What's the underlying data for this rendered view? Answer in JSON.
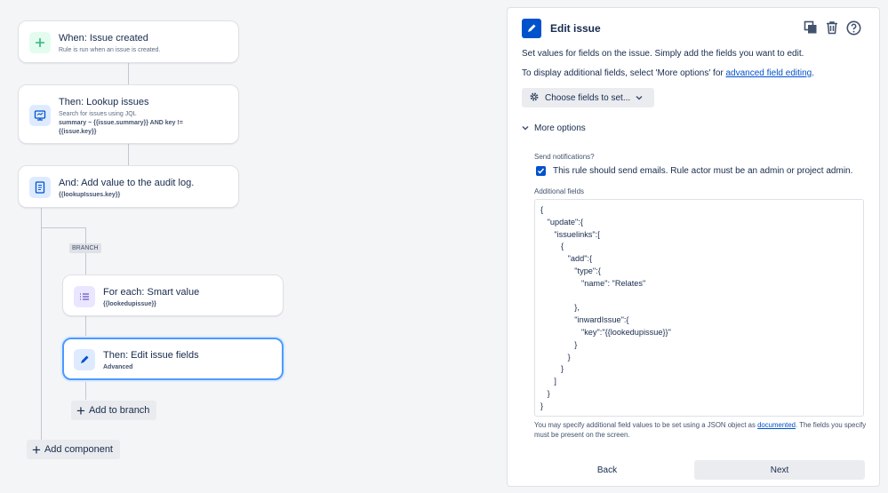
{
  "flow": {
    "trigger": {
      "title": "When: Issue created",
      "subtitle": "Rule is run when an issue is created."
    },
    "lookup": {
      "title": "Then: Lookup issues",
      "subtitle": "Search for issues using JQL",
      "jql_line1": "summary ~ {{issue.summary}} AND key !=",
      "jql_line2": "{{issue.key}}"
    },
    "audit": {
      "title": "And: Add value to the audit log.",
      "subtitle": "{{lookupIssues.key}}"
    },
    "branch_tag": "BRANCH",
    "foreach": {
      "title": "For each: Smart value",
      "subtitle": "{{lookedupissue}}"
    },
    "edit": {
      "title": "Then: Edit issue fields",
      "subtitle": "Advanced"
    },
    "add_to_branch": "Add to branch",
    "add_component": "Add component"
  },
  "panel": {
    "title": "Edit issue",
    "desc1": "Set values for fields on the issue. Simply add the fields you want to edit.",
    "desc2_prefix": "To display additional fields, select 'More options' for ",
    "desc2_link": "advanced field editing",
    "desc2_suffix": ".",
    "choose_fields": "Choose fields to set...",
    "more_options": "More options",
    "send_notifications_label": "Send notifications?",
    "send_notifications_text": "This rule should send emails. Rule actor must be an admin or project admin.",
    "send_notifications_checked": true,
    "additional_fields_label": "Additional fields",
    "additional_fields_value": "{\n   \"update\":{\n      \"issuelinks\":[\n         {\n            \"add\":{\n               \"type\":{\n                  \"name\": \"Relates\"\n\n               },\n               \"inwardIssue\":{\n                  \"key\":\"{{lookedupissue}}\"\n               }\n            }\n         }\n      ]\n   }\n}",
    "note_prefix": "You may specify additional field values to be set using a JSON object as ",
    "note_link": "documented",
    "note_suffix": ". The fields you specify must be present on the screen.",
    "back": "Back",
    "next": "Next"
  },
  "colors": {
    "accent": "#0052cc",
    "trigger_icon_bg": "#e3fcef",
    "trigger_icon": "#36b37e",
    "action_icon_bg": "#deebff",
    "branch_icon_bg": "#eae6ff",
    "branch_icon": "#6554c0"
  }
}
